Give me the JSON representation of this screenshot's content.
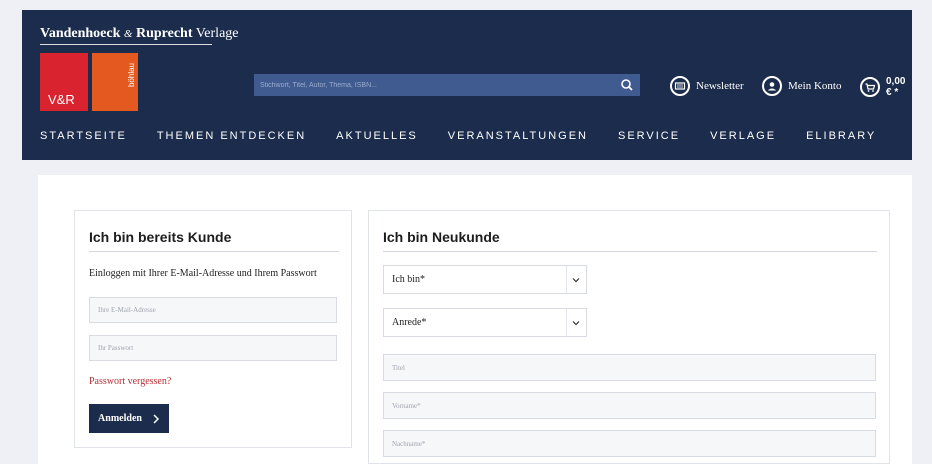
{
  "header": {
    "brand_bold": "Vandenhoeck",
    "brand_amp": "&",
    "brand_bold2": "Ruprecht",
    "brand_light": "Verlage",
    "logo_left_text": "V&R",
    "logo_right_text": "böhlau",
    "search_placeholder": "Stichwort, Titel, Autor, Thema, ISBN...",
    "newsletter_label": "Newsletter",
    "account_label": "Mein Konto",
    "cart_label": "0,00 € *",
    "colors": {
      "header_bg": "#1c2c4c",
      "logo_red": "#d9232e",
      "logo_orange": "#e3591f",
      "search_bg": "#3f5b90"
    }
  },
  "nav": {
    "items": [
      "STARTSEITE",
      "THEMEN ENTDECKEN",
      "AKTUELLES",
      "VERANSTALTUNGEN",
      "SERVICE",
      "VERLAGE",
      "ELIBRARY"
    ]
  },
  "login": {
    "title": "Ich bin bereits Kunde",
    "intro": "Einloggen mit Ihrer E-Mail-Adresse und Ihrem Passwort",
    "email_placeholder": "Ihre E-Mail-Adresse",
    "password_placeholder": "Ihr Passwort",
    "forgot_label": "Passwort vergessen?",
    "submit_label": "Anmelden",
    "submit_icon": "chevron-right-icon"
  },
  "register": {
    "title": "Ich bin Neukunde",
    "customer_type_value": "Ich bin*",
    "salutation_value": "Anrede*",
    "title_placeholder": "Titel",
    "firstname_placeholder": "Vorname*",
    "lastname_placeholder": "Nachname*"
  }
}
